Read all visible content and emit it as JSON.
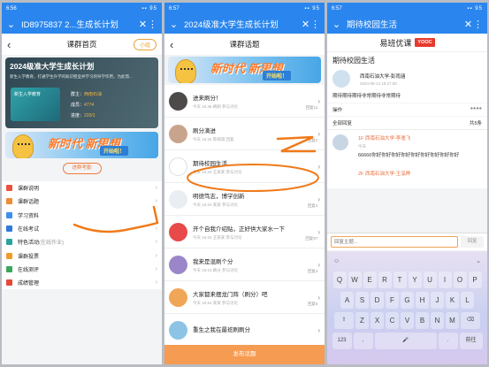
{
  "panel1": {
    "status_time": "6:56",
    "title": "ID8975837 2...生成长计划",
    "subtitle": "课群首页",
    "mini_label": "小组",
    "banner_slogan": "新时代 新思想",
    "banner_go": "开始啦！",
    "course_title": "2024级准大学生成长计划",
    "course_sub": "新生入学教育，打通学生升学的知识壁垒并学习的导学作用，为此而...",
    "book_label": "新生入学教育",
    "group_label": "群主：",
    "group_value": "西南石油",
    "score_label": "成员：",
    "score_value": "4774",
    "progress_label": "进度：",
    "progress_value": "220/1",
    "enter_label": "进群考勤",
    "menu": [
      {
        "label": "课群说明",
        "color": "#e95241"
      },
      {
        "label": "课群话题",
        "color": "#f08c31"
      },
      {
        "label": "学习资料",
        "color": "#3c8ef0"
      },
      {
        "label": "在线考试",
        "color": "#2f7bd8"
      },
      {
        "label": "特色活动",
        "extra": "(在线作业)",
        "color": "#29a3a0"
      },
      {
        "label": "课群投票",
        "color": "#f19b2c"
      },
      {
        "label": "在线测评",
        "color": "#3da55a"
      },
      {
        "label": "成绩管理",
        "color": "#e6483a"
      }
    ]
  },
  "panel2": {
    "status_time": "6:57",
    "title": "2024级准大学生成长计划",
    "subtitle": "课群话题",
    "banner_slogan": "新时代 新思想",
    "banner_go": "开始啦！",
    "topics": [
      {
        "title": "进来刷分！",
        "meta": "今天 16:36 刷刷 参与讨论",
        "replies": "回复11",
        "avatar": "#4f4a4a"
      },
      {
        "title": "刷分滴进",
        "meta": "今天 16:34 陈婉琪 回复",
        "replies": "回复2",
        "avatar": "#c9a48c"
      },
      {
        "title": "期待校园生活",
        "meta": "今天 16:16 王某某 参与讨论",
        "replies": "",
        "avatar": "#ffffff"
      },
      {
        "title": "明德笃志，博学创新",
        "meta": "今天 16:24 某某 参与讨论",
        "replies": "回复4",
        "avatar": "#e9eef3"
      },
      {
        "title": "开个自我介绍贴，正好供大家水一下",
        "meta": "今天 16:15 王某某 参与讨论",
        "replies": "回复97",
        "avatar": "#e84a4a"
      },
      {
        "title": "我来是混刷个分",
        "meta": "今天 16:10 刷分 参与讨论",
        "replies": "回复4",
        "avatar": "#9a86c9"
      },
      {
        "title": "大家都来摆龙门阵（刷分）吧",
        "meta": "今天 15:54 某某 参与讨论",
        "replies": "回复5",
        "avatar": "#f0a657"
      },
      {
        "title": "重生之我在最班刷刷分",
        "meta": "",
        "replies": "",
        "avatar": "#8dc4e6"
      }
    ],
    "post_button": "发布话题"
  },
  "panel3": {
    "status_time": "6:57",
    "title": "期待校园生活",
    "brand": "易班优课",
    "brand_badge": "YOOC",
    "post_title": "期待校园生活",
    "author": "西南石油大学-彭雨涵",
    "date": "2024-08-14 16:27:08",
    "content": "期待期待期待非常期待非常期待",
    "ops_label": "操作",
    "ops_mark": "●●●●",
    "all_replies": "全部回复",
    "reply_count": "共5条",
    "reply": {
      "floor_name": "1F  西南石油大学-李逸飞",
      "time": "今天",
      "text": "66666你好你好你好你好你好你好你好你好你好"
    },
    "reply2": "2F  西南石油大学-王泓晔",
    "input_placeholder": "回复主题...",
    "send_label": "回复",
    "kb_rows": [
      [
        "Q",
        "W",
        "E",
        "R",
        "T",
        "Y",
        "U",
        "I",
        "O",
        "P"
      ],
      [
        "A",
        "S",
        "D",
        "F",
        "G",
        "H",
        "J",
        "K",
        "L"
      ],
      [
        "Z",
        "X",
        "C",
        "V",
        "B",
        "N",
        "M"
      ]
    ],
    "kb_num": "123",
    "kb_go": "前往"
  }
}
